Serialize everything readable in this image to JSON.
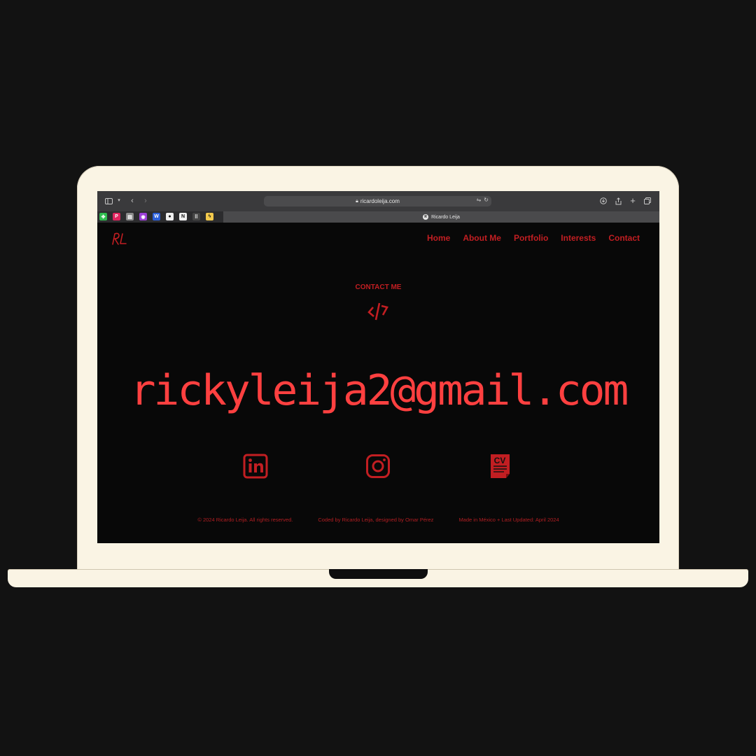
{
  "browser": {
    "url": "ricardoleija.com",
    "tab_title": "Ricardo Leija",
    "tab_favicon_letter": "R",
    "favorites": [
      {
        "icon": "clover-icon",
        "color": "#2fbd4f",
        "glyph": "✤"
      },
      {
        "icon": "p-app-icon",
        "color": "#e0245e",
        "glyph": "P"
      },
      {
        "icon": "doc-icon",
        "color": "#8a8a8a",
        "glyph": "▤"
      },
      {
        "icon": "purple-app-icon",
        "color": "#9b3fd6",
        "glyph": "◉"
      },
      {
        "icon": "word-icon",
        "color": "#2b5fd9",
        "glyph": "W"
      },
      {
        "icon": "github-icon",
        "color": "#f0f0f0",
        "glyph": "●"
      },
      {
        "icon": "notion-icon",
        "color": "#f0f0f0",
        "glyph": "N"
      },
      {
        "icon": "grid-app-icon",
        "color": "#444444",
        "glyph": "⠿"
      },
      {
        "icon": "bolt-app-icon",
        "color": "#f2c94c",
        "glyph": "ϟ"
      }
    ]
  },
  "site": {
    "logo_text": "RL",
    "nav": [
      "Home",
      "About Me",
      "Portfolio",
      "Interests",
      "Contact"
    ],
    "contact_label": "CONTACT ME",
    "email": "rickyleija2@gmail.com",
    "cv_label": "CV",
    "footer": [
      "© 2024 Ricardo Leija. All rights reserved.",
      "Coded by Ricardo Leija, designed by Omar Pérez",
      "Made in México + Last Updated: April 2024"
    ]
  },
  "colors": {
    "accent": "#c21e22",
    "email": "#ff4040",
    "background": "#121212",
    "laptop": "#faf4e4"
  }
}
